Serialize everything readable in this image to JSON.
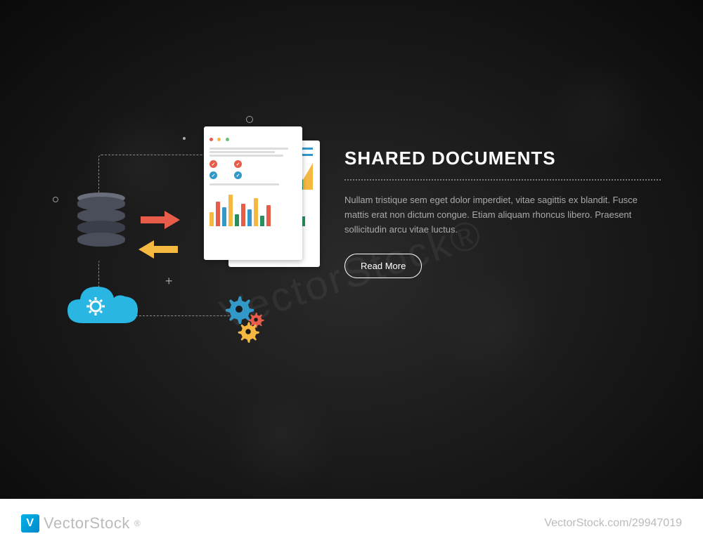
{
  "content": {
    "title": "SHARED DOCUMENTS",
    "body": "Nullam tristique sem eget dolor imperdiet, vitae sagittis ex blandit. Fusce mattis erat non dictum congue. Etiam aliquam rhoncus libero. Praesent sollicitudin arcu vitae luctus.",
    "cta_label": "Read More"
  },
  "footer": {
    "brand": "VectorStock",
    "brand_suffix": "®",
    "image_id": "29947019",
    "attribution_prefix": "VectorStock.com/"
  },
  "watermark": "VectorStock®",
  "colors": {
    "accent_cloud": "#29b6e3",
    "arrow_right": "#e85c4a",
    "arrow_left": "#f5b942",
    "gear1": "#3298c7",
    "gear2": "#e85c4a",
    "gear3": "#f5b942",
    "check_red": "#e85c4a",
    "check_blue": "#3298c7"
  }
}
